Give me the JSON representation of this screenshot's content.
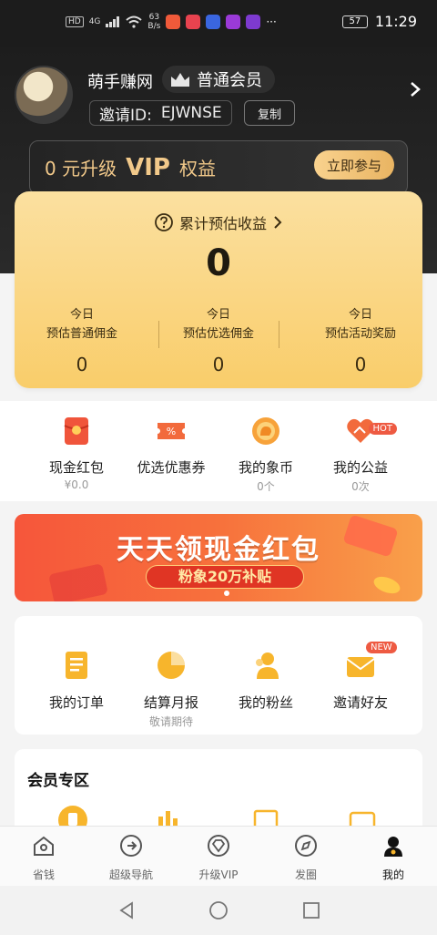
{
  "status_bar": {
    "network_badge": "HD",
    "signal": "4G",
    "speed_value": "63",
    "speed_unit": "B/s",
    "more": "···",
    "battery": "57",
    "time": "11:29"
  },
  "profile": {
    "nickname": "萌手赚网",
    "member_level": "普通会员",
    "invite_label": "邀请ID:",
    "invite_id": "EJWNSE",
    "copy_label": "复制"
  },
  "vip": {
    "prefix": "0 元升级",
    "vip_word": "VIP",
    "suffix": "权益",
    "cta": "立即参与"
  },
  "earnings": {
    "title": "累计预估收益",
    "total": "0",
    "columns": [
      {
        "line1": "今日",
        "line2": "预估普通佣金",
        "value": "0"
      },
      {
        "line1": "今日",
        "line2": "预估优选佣金",
        "value": "0"
      },
      {
        "line1": "今日",
        "line2": "预估活动奖励",
        "value": "0"
      }
    ]
  },
  "quick": [
    {
      "label": "现金红包",
      "sub": "¥0.0",
      "icon": "red-envelope-icon"
    },
    {
      "label": "优选优惠券",
      "sub": "",
      "icon": "coupon-icon"
    },
    {
      "label": "我的象币",
      "sub": "0个",
      "icon": "elephant-coin-icon"
    },
    {
      "label": "我的公益",
      "sub": "0次",
      "icon": "charity-heart-icon",
      "badge": "HOT"
    }
  ],
  "banner": {
    "title": "天天领现金红包",
    "subtitle": "粉象20万补贴"
  },
  "tools": [
    {
      "label": "我的订单",
      "sub": "",
      "icon": "order-list-icon"
    },
    {
      "label": "结算月报",
      "sub": "敬请期待",
      "icon": "pie-chart-icon"
    },
    {
      "label": "我的粉丝",
      "sub": "",
      "icon": "fans-icon"
    },
    {
      "label": "邀请好友",
      "sub": "",
      "icon": "invite-envelope-icon",
      "badge": "NEW"
    }
  ],
  "members": {
    "title": "会员专区"
  },
  "tabbar": [
    {
      "label": "省钱",
      "icon": "home-icon"
    },
    {
      "label": "超级导航",
      "icon": "navigation-arrow-icon"
    },
    {
      "label": "升级VIP",
      "icon": "diamond-icon"
    },
    {
      "label": "发圈",
      "icon": "compass-icon"
    },
    {
      "label": "我的",
      "icon": "profile-icon",
      "active": true
    }
  ],
  "colors": {
    "accent_gold": "#f9cd6a",
    "dark_bg": "#1c1c1c",
    "banner_red": "#f6563b",
    "badge_red": "#ee5a42"
  }
}
